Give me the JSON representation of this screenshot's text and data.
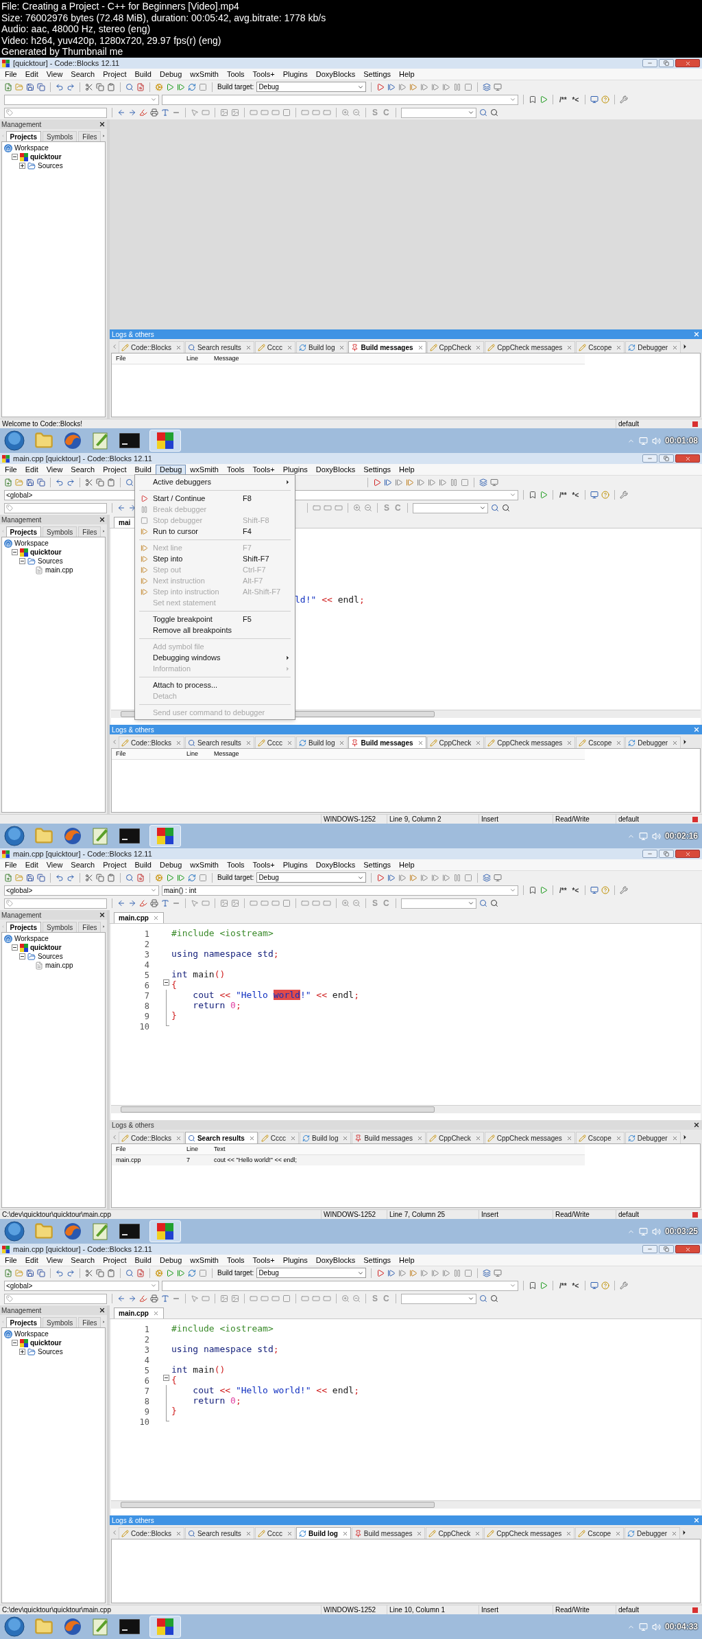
{
  "header": {
    "lines": [
      "File: Creating a Project - C++ for Beginners [Video].mp4",
      "Size: 76002976 bytes (72.48 MiB), duration: 00:05:42, avg.bitrate: 1778 kb/s",
      "Audio: aac, 48000 Hz, stereo (eng)",
      "Video: h264, yuv420p, 1280x720, 29.97 fps(r) (eng)",
      "Generated by Thumbnail me"
    ]
  },
  "frames": [
    {
      "window_title": "[quicktour] - Code::Blocks 12.11",
      "menu_bar": [
        {
          "label": "File",
          "selected": false
        },
        {
          "label": "Edit",
          "selected": false
        },
        {
          "label": "View",
          "selected": false
        },
        {
          "label": "Search",
          "selected": false
        },
        {
          "label": "Project",
          "selected": false
        },
        {
          "label": "Build",
          "selected": false
        },
        {
          "label": "Debug",
          "selected": false
        },
        {
          "label": "wxSmith",
          "selected": false
        },
        {
          "label": "Tools",
          "selected": false
        },
        {
          "label": "Tools+",
          "selected": false
        },
        {
          "label": "Plugins",
          "selected": false
        },
        {
          "label": "DoxyBlocks",
          "selected": false
        },
        {
          "label": "Settings",
          "selected": false
        },
        {
          "label": "Help",
          "selected": false
        }
      ],
      "build_target_label": "Build target:",
      "build_target": "Debug",
      "doxy_buttons": [
        "/**",
        "*<"
      ],
      "style_buttons": [
        "S",
        "C"
      ],
      "management": {
        "title": "Management",
        "tabs": [
          {
            "label": "Projects",
            "selected": true
          },
          {
            "label": "Symbols",
            "selected": false
          },
          {
            "label": "Files",
            "selected": false
          }
        ],
        "tree": [
          {
            "label": "Workspace",
            "kind": "workspace",
            "children": [
              {
                "label": "quicktour",
                "kind": "project",
                "expanded": true,
                "children": [
                  {
                    "label": "Sources",
                    "kind": "folder",
                    "expanded": false
                  }
                ]
              }
            ]
          }
        ]
      },
      "logs": {
        "title": "Logs & others",
        "focused": true,
        "tabs": [
          {
            "label": "Code::Blocks",
            "selected": false
          },
          {
            "label": "Search results",
            "selected": false
          },
          {
            "label": "Cccc",
            "selected": false
          },
          {
            "label": "Build log",
            "selected": false
          },
          {
            "label": "Build messages",
            "selected": true
          },
          {
            "label": "CppCheck",
            "selected": false
          },
          {
            "label": "CppCheck messages",
            "selected": false
          },
          {
            "label": "Cscope",
            "selected": false
          },
          {
            "label": "Debugger",
            "selected": false
          }
        ],
        "columns": [
          "File",
          "Line",
          "Message"
        ]
      },
      "status_bar": {
        "message": "Welcome to Code::Blocks!",
        "profile": "default"
      },
      "taskbar": {
        "timestamp": "00:01:08"
      }
    },
    {
      "window_title": "main.cpp [quicktour] - Code::Blocks 12.11",
      "menu_bar": [
        {
          "label": "File",
          "selected": false
        },
        {
          "label": "Edit",
          "selected": false
        },
        {
          "label": "View",
          "selected": false
        },
        {
          "label": "Search",
          "selected": false
        },
        {
          "label": "Project",
          "selected": false
        },
        {
          "label": "Build",
          "selected": false
        },
        {
          "label": "Debug",
          "selected": true
        },
        {
          "label": "wxSmith",
          "selected": false
        },
        {
          "label": "Tools",
          "selected": false
        },
        {
          "label": "Tools+",
          "selected": false
        },
        {
          "label": "Plugins",
          "selected": false
        },
        {
          "label": "DoxyBlocks",
          "selected": false
        },
        {
          "label": "Settings",
          "selected": false
        },
        {
          "label": "Help",
          "selected": false
        }
      ],
      "scope": "<global>",
      "doxy_buttons": [
        "/**",
        "*<"
      ],
      "style_buttons": [
        "S",
        "C"
      ],
      "debug_menu": [
        {
          "kind": "submenu",
          "label": "Active debuggers",
          "disabled": false
        },
        {
          "kind": "separator"
        },
        {
          "kind": "item",
          "label": "Start / Continue",
          "shortcut": "F8",
          "disabled": false
        },
        {
          "kind": "item",
          "label": "Break debugger",
          "disabled": true
        },
        {
          "kind": "item",
          "label": "Stop debugger",
          "shortcut": "Shift-F8",
          "disabled": true
        },
        {
          "kind": "item",
          "label": "Run to cursor",
          "shortcut": "F4",
          "disabled": false
        },
        {
          "kind": "separator"
        },
        {
          "kind": "item",
          "label": "Next line",
          "shortcut": "F7",
          "disabled": true
        },
        {
          "kind": "item",
          "label": "Step into",
          "shortcut": "Shift-F7",
          "disabled": false
        },
        {
          "kind": "item",
          "label": "Step out",
          "shortcut": "Ctrl-F7",
          "disabled": true
        },
        {
          "kind": "item",
          "label": "Next instruction",
          "shortcut": "Alt-F7",
          "disabled": true
        },
        {
          "kind": "item",
          "label": "Step into instruction",
          "shortcut": "Alt-Shift-F7",
          "disabled": true
        },
        {
          "kind": "item",
          "label": "Set next statement",
          "disabled": true
        },
        {
          "kind": "separator"
        },
        {
          "kind": "item",
          "label": "Toggle breakpoint",
          "shortcut": "F5",
          "disabled": false
        },
        {
          "kind": "item",
          "label": "Remove all breakpoints",
          "disabled": false
        },
        {
          "kind": "separator"
        },
        {
          "kind": "item",
          "label": "Add symbol file",
          "disabled": true
        },
        {
          "kind": "submenu",
          "label": "Debugging windows",
          "disabled": false
        },
        {
          "kind": "submenu",
          "label": "Information",
          "disabled": true
        },
        {
          "kind": "separator"
        },
        {
          "kind": "item",
          "label": "Attach to process...",
          "disabled": false
        },
        {
          "kind": "item",
          "label": "Detach",
          "disabled": true
        },
        {
          "kind": "separator"
        },
        {
          "kind": "item",
          "label": "Send user command to debugger",
          "disabled": true
        }
      ],
      "management": {
        "title": "Management",
        "tabs": [
          {
            "label": "Projects",
            "selected": true
          },
          {
            "label": "Symbols",
            "selected": false
          },
          {
            "label": "Files",
            "selected": false
          }
        ],
        "tree": [
          {
            "label": "Workspace",
            "kind": "workspace",
            "children": [
              {
                "label": "quicktour",
                "kind": "project",
                "expanded": true,
                "children": [
                  {
                    "label": "Sources",
                    "kind": "folder",
                    "expanded": true,
                    "children": [
                      {
                        "label": "main.cpp",
                        "kind": "file"
                      }
                    ]
                  }
                ]
              }
            ]
          }
        ]
      },
      "editor": {
        "clipped": true,
        "tabs": [
          {
            "label": "mai",
            "selected": true
          }
        ],
        "lines": [
          {
            "kind": "code",
            "tokens": [
              {
                "text": "ld!\"",
                "kind": "string"
              },
              {
                "text": " << ",
                "kind": "op"
              },
              {
                "text": "endl",
                "kind": "plain"
              },
              {
                "text": ";",
                "kind": "op"
              }
            ]
          }
        ]
      },
      "logs": {
        "title": "Logs & others",
        "focused": true,
        "tabs": [
          {
            "label": "Code::Blocks",
            "selected": false
          },
          {
            "label": "Search results",
            "selected": false
          },
          {
            "label": "Cccc",
            "selected": false
          },
          {
            "label": "Build log",
            "selected": false
          },
          {
            "label": "Build messages",
            "selected": true
          },
          {
            "label": "CppCheck",
            "selected": false
          },
          {
            "label": "CppCheck messages",
            "selected": false
          },
          {
            "label": "Cscope",
            "selected": false
          },
          {
            "label": "Debugger",
            "selected": false
          }
        ],
        "columns": [
          "File",
          "Line",
          "Message"
        ]
      },
      "status_bar": {
        "encoding": "WINDOWS-1252",
        "position": "Line 9, Column 2",
        "mode": "Insert",
        "access": "Read/Write",
        "profile": "default"
      },
      "taskbar": {
        "timestamp": "00:02:16"
      }
    },
    {
      "window_title": "main.cpp [quicktour] - Code::Blocks 12.11",
      "menu_bar": [
        {
          "label": "File",
          "selected": false
        },
        {
          "label": "Edit",
          "selected": false
        },
        {
          "label": "View",
          "selected": false
        },
        {
          "label": "Search",
          "selected": false
        },
        {
          "label": "Project",
          "selected": false
        },
        {
          "label": "Build",
          "selected": false
        },
        {
          "label": "Debug",
          "selected": false
        },
        {
          "label": "wxSmith",
          "selected": false
        },
        {
          "label": "Tools",
          "selected": false
        },
        {
          "label": "Tools+",
          "selected": false
        },
        {
          "label": "Plugins",
          "selected": false
        },
        {
          "label": "DoxyBlocks",
          "selected": false
        },
        {
          "label": "Settings",
          "selected": false
        },
        {
          "label": "Help",
          "selected": false
        }
      ],
      "build_target_label": "Build target:",
      "build_target": "Debug",
      "scope": "<global>",
      "function": "main() : int",
      "doxy_buttons": [
        "/**",
        "*<"
      ],
      "style_buttons": [
        "S",
        "C"
      ],
      "management": {
        "title": "Management",
        "tabs": [
          {
            "label": "Projects",
            "selected": true
          },
          {
            "label": "Symbols",
            "selected": false
          },
          {
            "label": "Files",
            "selected": false
          }
        ],
        "tree": [
          {
            "label": "Workspace",
            "kind": "workspace",
            "children": [
              {
                "label": "quicktour",
                "kind": "project",
                "expanded": true,
                "children": [
                  {
                    "label": "Sources",
                    "kind": "folder",
                    "expanded": true,
                    "children": [
                      {
                        "label": "main.cpp",
                        "kind": "file"
                      }
                    ]
                  }
                ]
              }
            ]
          }
        ]
      },
      "editor": {
        "clipped": false,
        "tabs": [
          {
            "label": "main.cpp",
            "selected": true
          }
        ],
        "lines": [
          {
            "kind": "code",
            "number": "1",
            "tokens": [
              {
                "text": "#include <iostream>",
                "kind": "preproc"
              }
            ]
          },
          {
            "kind": "code",
            "number": "2"
          },
          {
            "kind": "code",
            "number": "3",
            "tokens": [
              {
                "text": "using namespace std",
                "kind": "keyword"
              },
              {
                "text": ";",
                "kind": "op"
              }
            ]
          },
          {
            "kind": "code",
            "number": "4"
          },
          {
            "kind": "code",
            "number": "5",
            "tokens": [
              {
                "text": "int",
                "kind": "keyword"
              },
              {
                "text": " main",
                "kind": "plain"
              },
              {
                "text": "()",
                "kind": "op"
              }
            ]
          },
          {
            "kind": "fold_start",
            "number": "6",
            "tokens": [
              {
                "text": "{",
                "kind": "op"
              }
            ]
          },
          {
            "kind": "fold_body",
            "number": "7",
            "tokens": [
              {
                "text": "    cout",
                "kind": "keyword"
              },
              {
                "text": " << ",
                "kind": "op"
              },
              {
                "text": "\"Hello ",
                "kind": "string"
              },
              {
                "text": "world",
                "kind": "match"
              },
              {
                "text": "!\"",
                "kind": "string"
              },
              {
                "text": " << ",
                "kind": "op"
              },
              {
                "text": "endl",
                "kind": "plain"
              },
              {
                "text": ";",
                "kind": "op"
              }
            ]
          },
          {
            "kind": "fold_body",
            "number": "8",
            "tokens": [
              {
                "text": "    return",
                "kind": "keyword"
              },
              {
                "text": " 0",
                "kind": "number"
              },
              {
                "text": ";",
                "kind": "op"
              }
            ]
          },
          {
            "kind": "fold_body",
            "number": "9",
            "tokens": [
              {
                "text": "}",
                "kind": "op"
              }
            ]
          },
          {
            "kind": "fold_end",
            "number": "10"
          }
        ]
      },
      "logs": {
        "title": "Logs & others",
        "focused": false,
        "tabs": [
          {
            "label": "Code::Blocks",
            "selected": false
          },
          {
            "label": "Search results",
            "selected": true
          },
          {
            "label": "Cccc",
            "selected": false
          },
          {
            "label": "Build log",
            "selected": false
          },
          {
            "label": "Build messages",
            "selected": false
          },
          {
            "label": "CppCheck",
            "selected": false
          },
          {
            "label": "CppCheck messages",
            "selected": false
          },
          {
            "label": "Cscope",
            "selected": false
          },
          {
            "label": "Debugger",
            "selected": false
          }
        ],
        "columns": [
          "File",
          "Line",
          "Text"
        ],
        "rows": [
          [
            "main.cpp",
            "7",
            "cout << \"Hello world!\" << endl;"
          ]
        ]
      },
      "status_bar": {
        "message": "C:\\dev\\quicktour\\quicktour\\main.cpp",
        "encoding": "WINDOWS-1252",
        "position": "Line 7, Column 25",
        "mode": "Insert",
        "access": "Read/Write",
        "profile": "default"
      },
      "taskbar": {
        "timestamp": "00:03:25"
      }
    },
    {
      "window_title": "main.cpp [quicktour] - Code::Blocks 12.11",
      "menu_bar": [
        {
          "label": "File",
          "selected": false
        },
        {
          "label": "Edit",
          "selected": false
        },
        {
          "label": "View",
          "selected": false
        },
        {
          "label": "Search",
          "selected": false
        },
        {
          "label": "Project",
          "selected": false
        },
        {
          "label": "Build",
          "selected": false
        },
        {
          "label": "Debug",
          "selected": false
        },
        {
          "label": "wxSmith",
          "selected": false
        },
        {
          "label": "Tools",
          "selected": false
        },
        {
          "label": "Tools+",
          "selected": false
        },
        {
          "label": "Plugins",
          "selected": false
        },
        {
          "label": "DoxyBlocks",
          "selected": false
        },
        {
          "label": "Settings",
          "selected": false
        },
        {
          "label": "Help",
          "selected": false
        }
      ],
      "build_target_label": "Build target:",
      "build_target": "Debug",
      "scope": "<global>",
      "doxy_buttons": [
        "/**",
        "*<"
      ],
      "style_buttons": [
        "S",
        "C"
      ],
      "management": {
        "title": "Management",
        "tabs": [
          {
            "label": "Projects",
            "selected": true
          },
          {
            "label": "Symbols",
            "selected": false
          },
          {
            "label": "Files",
            "selected": false
          }
        ],
        "tree": [
          {
            "label": "Workspace",
            "kind": "workspace",
            "children": [
              {
                "label": "quicktour",
                "kind": "project",
                "expanded": true,
                "children": [
                  {
                    "label": "Sources",
                    "kind": "folder",
                    "expanded": false
                  }
                ]
              }
            ]
          }
        ]
      },
      "editor": {
        "clipped": false,
        "tabs": [
          {
            "label": "main.cpp",
            "selected": true
          }
        ],
        "lines": [
          {
            "kind": "code",
            "number": "1",
            "tokens": [
              {
                "text": "#include <iostream>",
                "kind": "preproc"
              }
            ]
          },
          {
            "kind": "code",
            "number": "2"
          },
          {
            "kind": "code",
            "number": "3",
            "tokens": [
              {
                "text": "using namespace std",
                "kind": "keyword"
              },
              {
                "text": ";",
                "kind": "op"
              }
            ]
          },
          {
            "kind": "code",
            "number": "4"
          },
          {
            "kind": "code",
            "number": "5",
            "tokens": [
              {
                "text": "int",
                "kind": "keyword"
              },
              {
                "text": " main",
                "kind": "plain"
              },
              {
                "text": "()",
                "kind": "op"
              }
            ]
          },
          {
            "kind": "fold_start",
            "number": "6",
            "tokens": [
              {
                "text": "{",
                "kind": "op"
              }
            ]
          },
          {
            "kind": "fold_body",
            "number": "7",
            "tokens": [
              {
                "text": "    cout",
                "kind": "keyword"
              },
              {
                "text": " << ",
                "kind": "op"
              },
              {
                "text": "\"Hello world!\"",
                "kind": "string"
              },
              {
                "text": " << ",
                "kind": "op"
              },
              {
                "text": "endl",
                "kind": "plain"
              },
              {
                "text": ";",
                "kind": "op"
              }
            ]
          },
          {
            "kind": "fold_body",
            "number": "8",
            "tokens": [
              {
                "text": "    return",
                "kind": "keyword"
              },
              {
                "text": " 0",
                "kind": "number"
              },
              {
                "text": ";",
                "kind": "op"
              }
            ]
          },
          {
            "kind": "fold_body",
            "number": "9",
            "tokens": [
              {
                "text": "}",
                "kind": "op"
              }
            ]
          },
          {
            "kind": "fold_end",
            "number": "10"
          }
        ]
      },
      "logs": {
        "title": "Logs & others",
        "focused": true,
        "tabs": [
          {
            "label": "Code::Blocks",
            "selected": false
          },
          {
            "label": "Search results",
            "selected": false
          },
          {
            "label": "Cccc",
            "selected": false
          },
          {
            "label": "Build log",
            "selected": true
          },
          {
            "label": "Build messages",
            "selected": false
          },
          {
            "label": "CppCheck",
            "selected": false
          },
          {
            "label": "CppCheck messages",
            "selected": false
          },
          {
            "label": "Cscope",
            "selected": false
          },
          {
            "label": "Debugger",
            "selected": false
          }
        ]
      },
      "status_bar": {
        "message": "C:\\dev\\quicktour\\quicktour\\main.cpp",
        "encoding": "WINDOWS-1252",
        "position": "Line 10, Column 1",
        "mode": "Insert",
        "access": "Read/Write",
        "profile": "default"
      },
      "taskbar": {
        "timestamp": "00:04:33"
      }
    }
  ]
}
